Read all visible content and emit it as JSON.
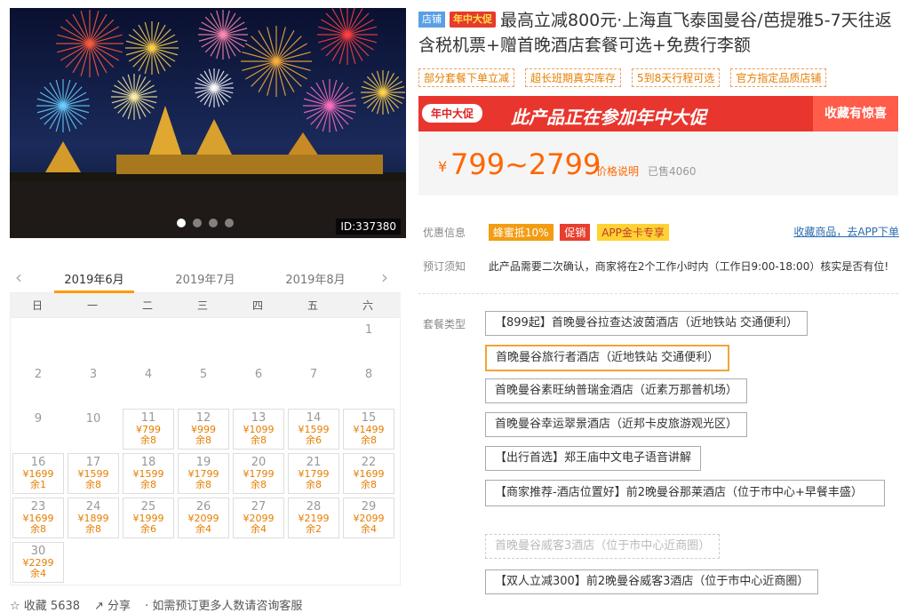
{
  "hero": {
    "id_label": "ID:337380"
  },
  "calendar": {
    "months": [
      "2019年6月",
      "2019年7月",
      "2019年8月"
    ],
    "weekdays": [
      "日",
      "一",
      "二",
      "三",
      "四",
      "五",
      "六"
    ],
    "first_weekday": 6,
    "days": 30,
    "prices": {
      "11": [
        "¥799",
        "余8"
      ],
      "12": [
        "¥999",
        "余8"
      ],
      "13": [
        "¥1099",
        "余8"
      ],
      "14": [
        "¥1599",
        "余6"
      ],
      "15": [
        "¥1499",
        "余8"
      ],
      "16": [
        "¥1699",
        "余1"
      ],
      "17": [
        "¥1599",
        "余8"
      ],
      "18": [
        "¥1599",
        "余8"
      ],
      "19": [
        "¥1799",
        "余8"
      ],
      "20": [
        "¥1799",
        "余8"
      ],
      "21": [
        "¥1799",
        "余8"
      ],
      "22": [
        "¥1699",
        "余8"
      ],
      "23": [
        "¥1699",
        "余8"
      ],
      "24": [
        "¥1899",
        "余8"
      ],
      "25": [
        "¥1999",
        "余6"
      ],
      "26": [
        "¥2099",
        "余4"
      ],
      "27": [
        "¥2099",
        "余4"
      ],
      "28": [
        "¥2199",
        "余2"
      ],
      "29": [
        "¥2099",
        "余4"
      ],
      "30": [
        "¥2299",
        "余4"
      ]
    }
  },
  "bottom": {
    "fav": "收藏 5638",
    "share": "分享",
    "note": "· 如需预订更多人数请咨询客服"
  },
  "product": {
    "shop_badge": "店铺",
    "promo_badge": "年中大促",
    "title": "最高立减800元·上海直飞泰国曼谷/芭提雅5-7天往返含税机票+赠首晚酒店套餐可选+免费行李额",
    "tags": [
      "部分套餐下单立减",
      "超长班期真实库存",
      "5到8天行程可选",
      "官方指定品质店铺"
    ]
  },
  "banner": {
    "logo": "年中大促",
    "text": "此产品正在参加年中大促",
    "right": "收藏有惊喜"
  },
  "price": {
    "currency": "¥",
    "range": "799~2799",
    "explain": "价格说明",
    "sold": "已售4060"
  },
  "discount": {
    "label": "优惠信息",
    "pills": [
      "蜂蜜抵10%",
      "促销",
      "APP金卡专享"
    ],
    "link": "收藏商品，去APP下单"
  },
  "notice": {
    "label": "预订须知",
    "text": "此产品需要二次确认，商家将在2个工作小时内（工作日9:00-18:00）核实是否有位!"
  },
  "packages": {
    "label": "套餐类型",
    "items": [
      "【899起】首晚曼谷拉查达波茵酒店（近地铁站 交通便利）",
      "首晚曼谷旅行者酒店（近地铁站 交通便利）",
      "首晚曼谷素旺纳普瑞金酒店（近素万那普机场）",
      "首晚曼谷幸运翠景酒店（近邦卡皮旅游观光区）",
      "【出行首选】郑王庙中文电子语音讲解",
      "【商家推荐-酒店位置好】前2晚曼谷那莱酒店（位于市中心+早餐丰盛）",
      "首晚曼谷威客3酒店（位于市中心近商圈）",
      "【双人立减300】前2晚曼谷威客3酒店（位于市中心近商圈）"
    ]
  },
  "colors": {
    "accent": "#ff6600",
    "promo": "#e8362e",
    "select": "#f3a23a"
  }
}
